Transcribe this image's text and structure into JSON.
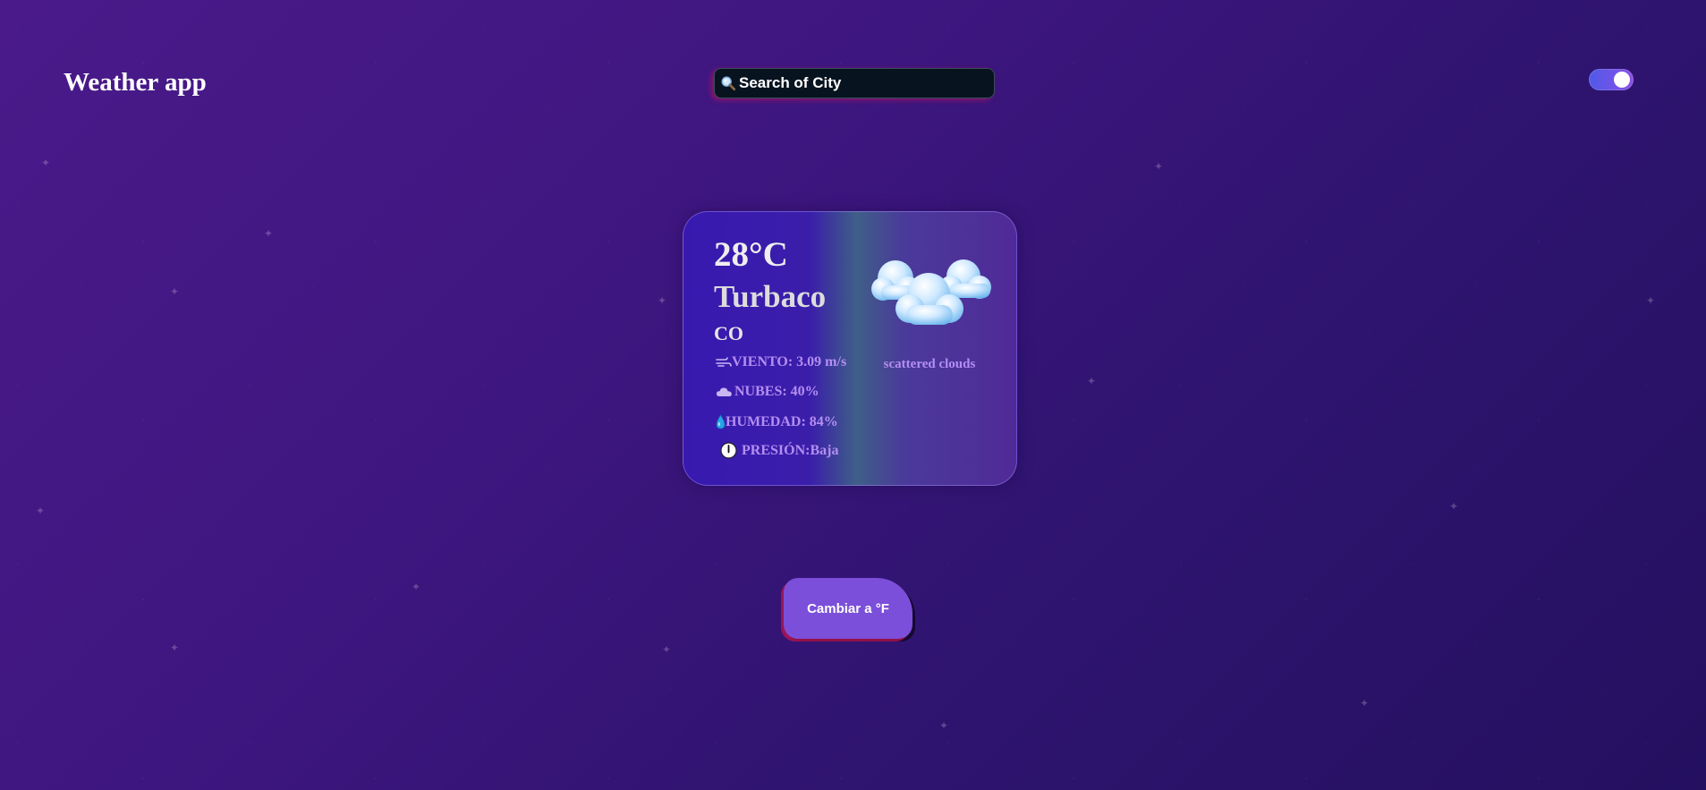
{
  "header": {
    "title": "Weather app"
  },
  "search": {
    "placeholder": "Search of City",
    "icon": "search-icon"
  },
  "theme_toggle": {
    "state": "on",
    "colors": {
      "track_start": "#4f5ae8",
      "track_end": "#8a4fe6",
      "knob": "#ffffff"
    }
  },
  "weather": {
    "temperature": "28°C",
    "city": "Turbaco",
    "country": "CO",
    "wind": "VIENTO: 3.09 m/s",
    "clouds": "NUBES: 40%",
    "humidity": "HUMEDAD: 84%",
    "pressure": "PRESIÓN:Baja",
    "description": "scattered clouds",
    "icon": "scattered-clouds-icon",
    "detail_icons": [
      "wind-icon",
      "cloud-icon",
      "water-drop-icon",
      "clock-icon"
    ]
  },
  "unit_button": {
    "label": "Cambiar a °F"
  },
  "colors": {
    "background_start": "#4a1a8a",
    "background_end": "#24105f",
    "detail_text": "#b48ef0",
    "button": "#7b4fd9"
  }
}
